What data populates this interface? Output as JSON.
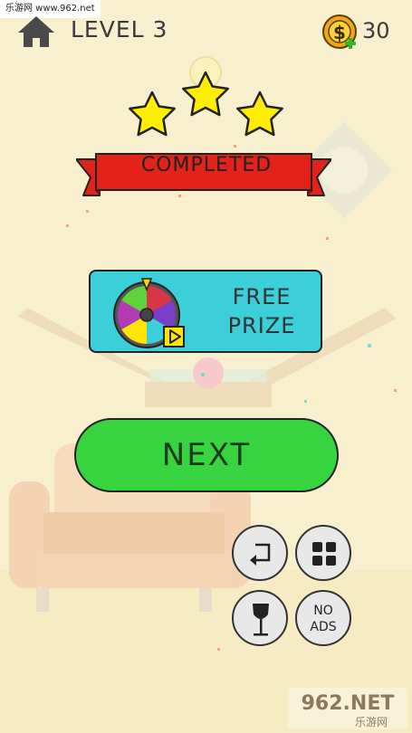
{
  "watermark_top": "乐游网 www.962.net",
  "header": {
    "level_label": "LEVEL 3",
    "coins": "30",
    "home_icon": "home-icon",
    "coin_icon": "dollar-coin-plus-icon"
  },
  "result": {
    "stars_earned": 3,
    "stars_total": 3,
    "banner_text": "COMPLETED"
  },
  "prize": {
    "line1": "FREE",
    "line2": "PRIZE",
    "icon": "prize-wheel-icon",
    "play_icon": "play-video-icon"
  },
  "next_label": "NEXT",
  "tools": {
    "restart_icon": "restart-icon",
    "levels_icon": "grid-icon",
    "glass_icon": "wine-glass-icon",
    "noads_line1": "NO",
    "noads_line2": "ADS"
  },
  "watermark_bottom": {
    "brand": "962.NET",
    "sub": "乐游网"
  },
  "colors": {
    "background": "#f8efcf",
    "ribbon": "#e32219",
    "star": "#ffee00",
    "prize_button": "#3ccfd9",
    "next_button": "#38d440"
  }
}
